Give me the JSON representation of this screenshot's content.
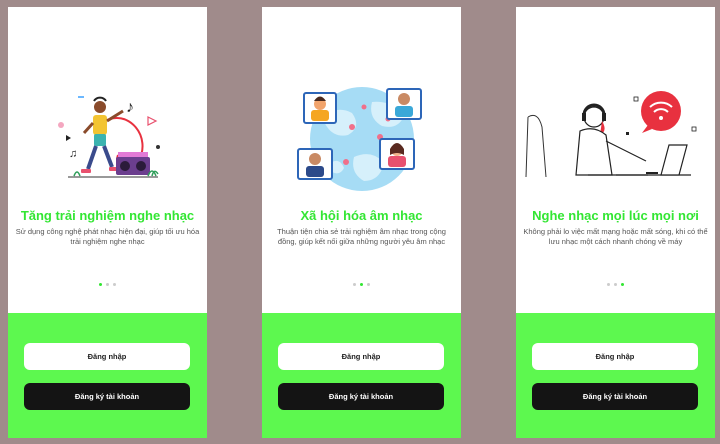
{
  "colors": {
    "accent": "#33e633",
    "bottom_panel": "#5df84f",
    "primary_button": "#141414",
    "background": "#a08b8b"
  },
  "screens": [
    {
      "title": "Tăng trải nghiệm nghe nhạc",
      "description": "Sử dụng công nghệ phát nhạc hiện đại, giúp tối ưu hóa trải nghiệm nghe nhạc",
      "active_dot": 1,
      "illustration": "singer-with-headphones-illustration",
      "login_label": "Đăng nhập",
      "register_label": "Đăng ký tài khoản"
    },
    {
      "title": "Xã hội hóa âm nhạc",
      "description": "Thuận tiện chia sẻ trải nghiệm âm nhạc trong cộng đồng, giúp kết nối giữa những người yêu âm nhạc",
      "active_dot": 2,
      "illustration": "global-community-illustration",
      "login_label": "Đăng nhập",
      "register_label": "Đăng ký tài khoản"
    },
    {
      "title": "Nghe nhạc mọi lúc mọi nơi",
      "description": "Không phải lo việc mất mạng hoặc mất sóng, khi có thể lưu nhạc một cách nhanh chóng về máy",
      "active_dot": 3,
      "illustration": "offline-listening-illustration",
      "login_label": "Đăng nhập",
      "register_label": "Đăng ký tài khoản"
    }
  ]
}
